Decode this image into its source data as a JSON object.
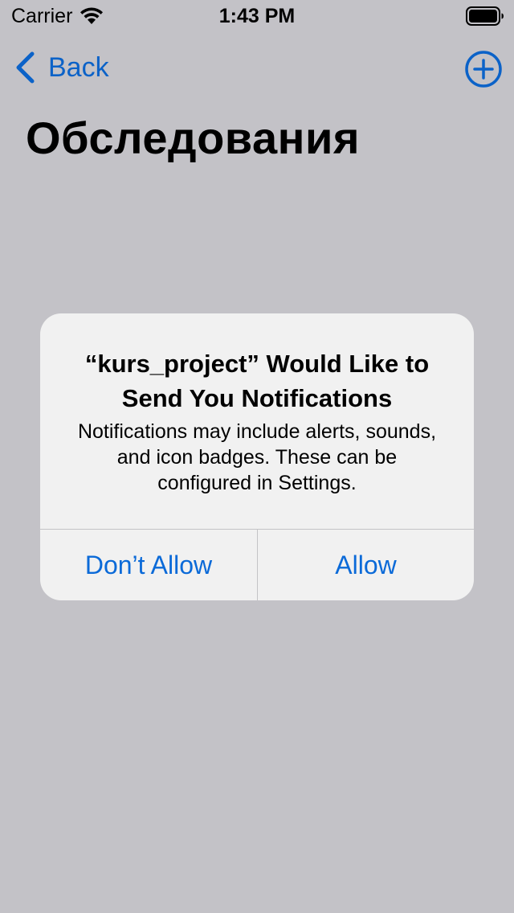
{
  "status_bar": {
    "carrier": "Carrier",
    "time": "1:43 PM",
    "icons": [
      "wifi-icon",
      "battery-icon"
    ]
  },
  "nav": {
    "back_label": "Back",
    "back_icon": "chevron-left-icon",
    "add_icon": "plus-circle-icon",
    "accent_color": "#0b62c8"
  },
  "page": {
    "title": "Обследования",
    "background_color": "#c3c2c7"
  },
  "alert": {
    "title": "“kurs_project” Would Like to Send You Notifications",
    "message": "Notifications may include alerts, sounds, and icon badges. These can be configured in Settings.",
    "buttons": {
      "dont_allow": "Don’t Allow",
      "allow": "Allow"
    },
    "button_color": "#0b6ad8"
  }
}
